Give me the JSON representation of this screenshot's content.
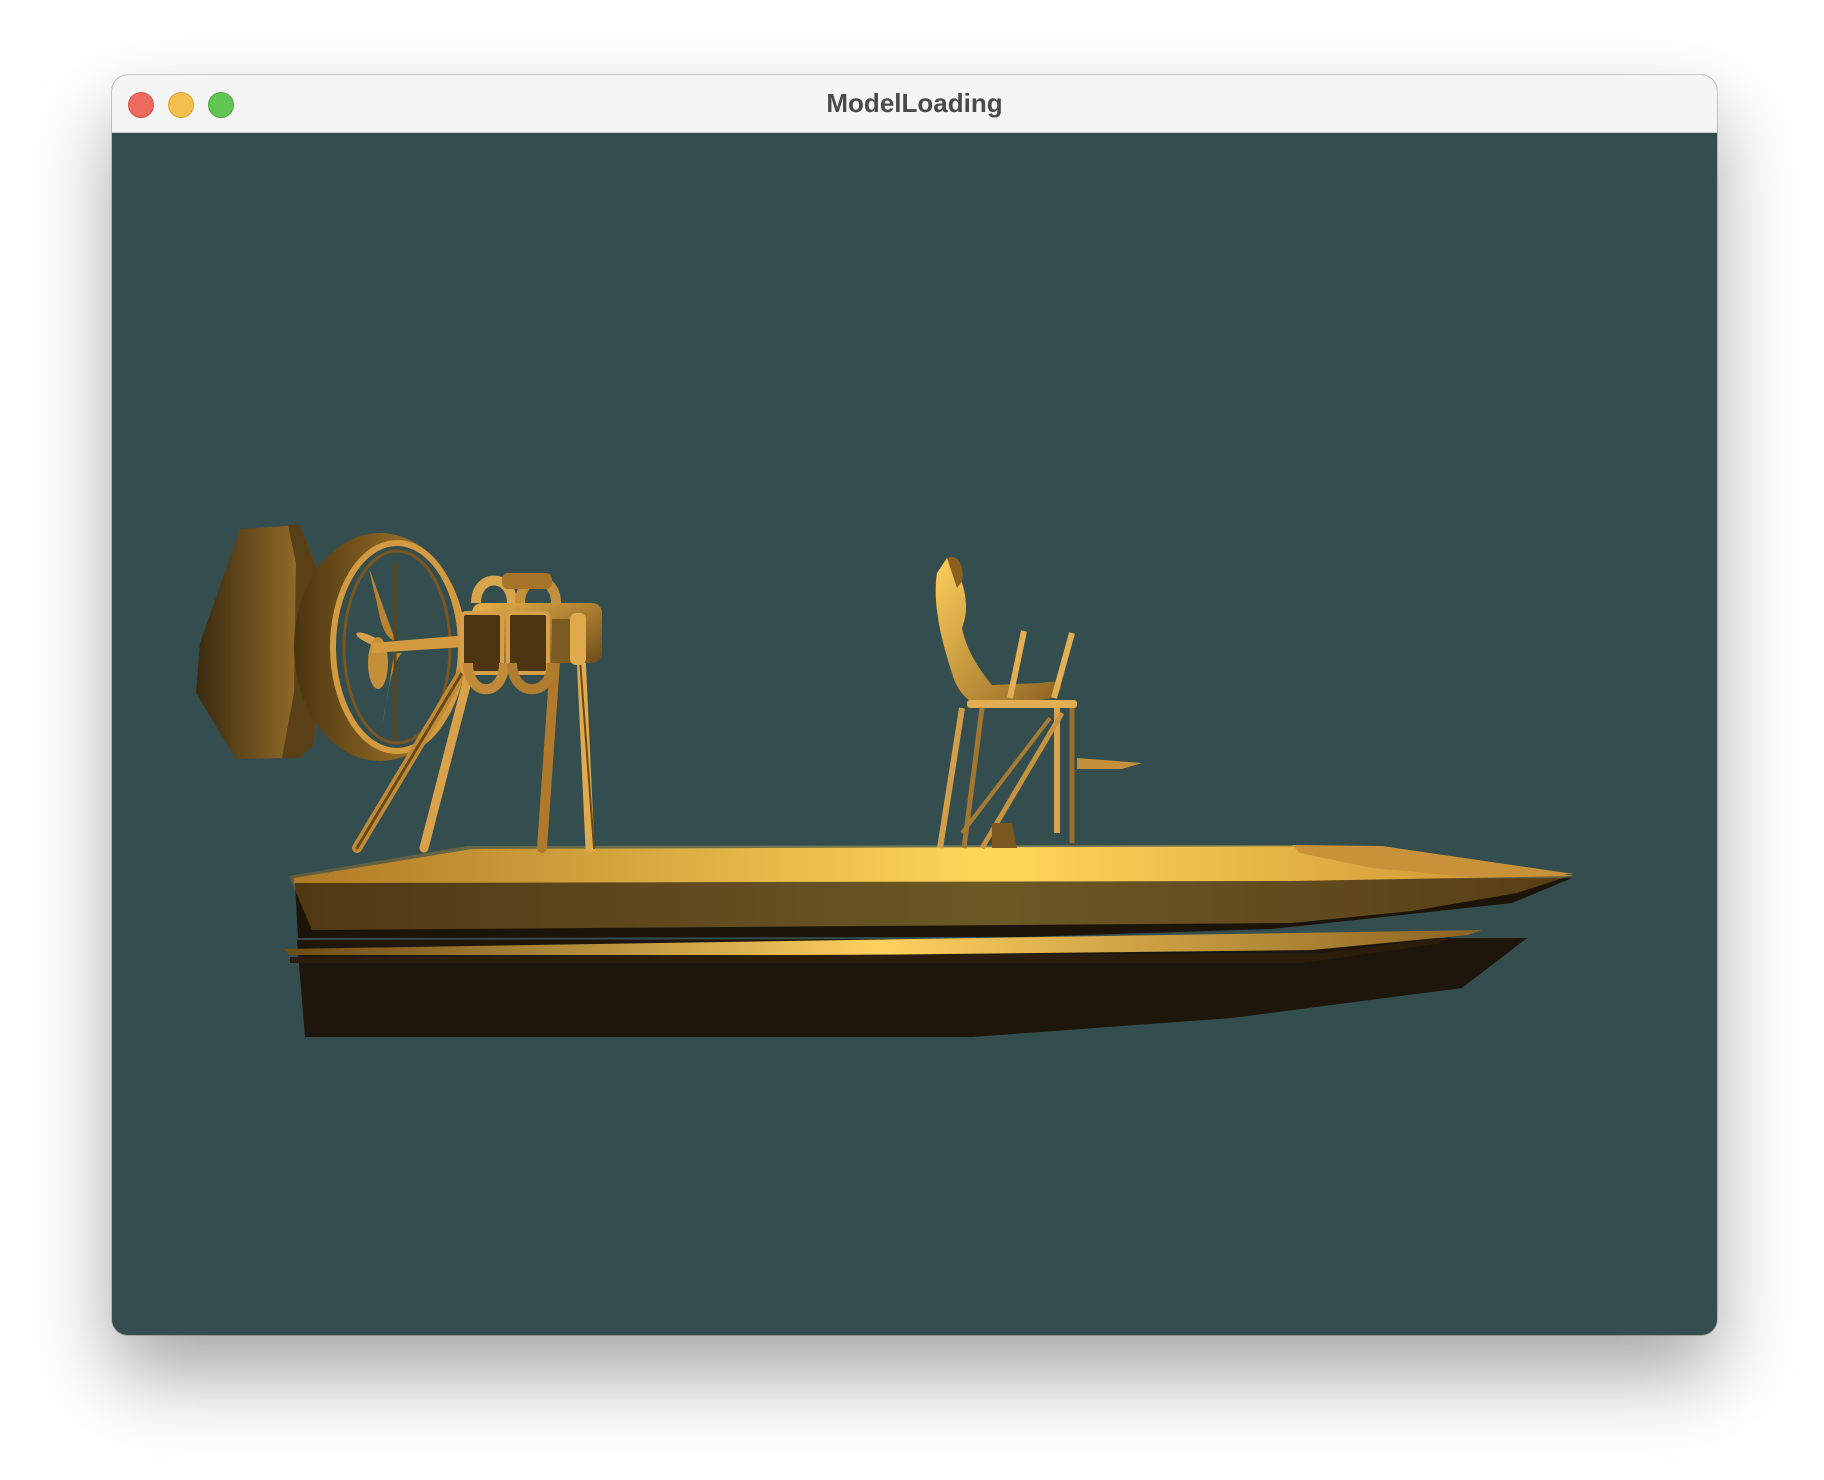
{
  "window": {
    "title": "ModelLoading",
    "controls": [
      "close-icon",
      "minimize-icon",
      "zoom-icon"
    ]
  },
  "viewport": {
    "background_color": "#344d4e",
    "model_color": "#e6a840",
    "scene": "airboat-3d-model"
  }
}
